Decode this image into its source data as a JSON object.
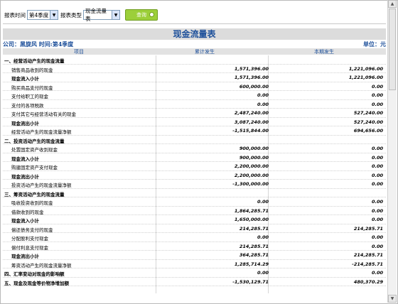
{
  "toolbar": {
    "period_label": "报表时间",
    "period_value": "第4季度",
    "type_label": "报表类型",
    "type_value": "现金流量表",
    "query_label": "查询"
  },
  "report": {
    "title": "现金流量表",
    "company": "公司：黑旋风  时间:第4季度",
    "unit": "单位：元",
    "columns": [
      "项目",
      "累计发生",
      "本期发生"
    ],
    "rows": [
      {
        "label": "一、经营活动产生的现金流量",
        "cum": "",
        "cur": "",
        "kind": "sec"
      },
      {
        "label": "销售商品收到的现金",
        "cum": "1,571,396.00",
        "cur": "1,221,096.00",
        "kind": "item"
      },
      {
        "label": "现金流入小计",
        "cum": "1,571,396.00",
        "cur": "1,221,096.00",
        "kind": "sub"
      },
      {
        "label": "购买商品支付的现金",
        "cum": "600,000.00",
        "cur": "0.00",
        "kind": "item"
      },
      {
        "label": "支付给职工的现金",
        "cum": "0.00",
        "cur": "0.00",
        "kind": "item"
      },
      {
        "label": "支付的各项税款",
        "cum": "0.00",
        "cur": "0.00",
        "kind": "item"
      },
      {
        "label": "支付其它与经营活动有关的现金",
        "cum": "2,487,240.00",
        "cur": "527,240.00",
        "kind": "item"
      },
      {
        "label": "现金流出小计",
        "cum": "3,087,240.00",
        "cur": "527,240.00",
        "kind": "sub"
      },
      {
        "label": "经营活动产生的现金流量净额",
        "cum": "-1,515,844.00",
        "cur": "694,656.00",
        "kind": "item"
      },
      {
        "label": "二、投资活动产生的现金流量",
        "cum": "",
        "cur": "",
        "kind": "sec"
      },
      {
        "label": "处置固定资产收到现金",
        "cum": "900,000.00",
        "cur": "0.00",
        "kind": "item"
      },
      {
        "label": "现金流入小计",
        "cum": "900,000.00",
        "cur": "0.00",
        "kind": "sub"
      },
      {
        "label": "购建固定资产支付现金",
        "cum": "2,200,000.00",
        "cur": "0.00",
        "kind": "item"
      },
      {
        "label": "现金流出小计",
        "cum": "2,200,000.00",
        "cur": "0.00",
        "kind": "sub"
      },
      {
        "label": "投资活动产生的现金流量净额",
        "cum": "-1,300,000.00",
        "cur": "0.00",
        "kind": "item"
      },
      {
        "label": "三、筹资活动产生的现金流量",
        "cum": "",
        "cur": "",
        "kind": "sec"
      },
      {
        "label": "吸收投资收到的现金",
        "cum": "0.00",
        "cur": "0.00",
        "kind": "item"
      },
      {
        "label": "借款收到的现金",
        "cum": "1,864,285.71",
        "cur": "0.00",
        "kind": "item"
      },
      {
        "label": "现金流入小计",
        "cum": "1,650,000.00",
        "cur": "0.00",
        "kind": "sub"
      },
      {
        "label": "偿还债务支付的现金",
        "cum": "214,285.71",
        "cur": "214,285.71",
        "kind": "item"
      },
      {
        "label": "分配股利支付现金",
        "cum": "0.00",
        "cur": "0.00",
        "kind": "item"
      },
      {
        "label": "偿付利息支付现金",
        "cum": "214,285.71",
        "cur": "0.00",
        "kind": "item"
      },
      {
        "label": "现金流出小计",
        "cum": "364,285.71",
        "cur": "214,285.71",
        "kind": "sub"
      },
      {
        "label": "筹资活动产生的现金流量净额",
        "cum": "1,285,714.29",
        "cur": "-214,285.71",
        "kind": "item"
      },
      {
        "label": "四、汇率变动对现金的影响额",
        "cum": "0.00",
        "cur": "0.00",
        "kind": "sec"
      },
      {
        "label": "五、现金及现金等价物净增加额",
        "cum": "-1,530,129.71",
        "cur": "480,370.29",
        "kind": "sec"
      }
    ]
  }
}
